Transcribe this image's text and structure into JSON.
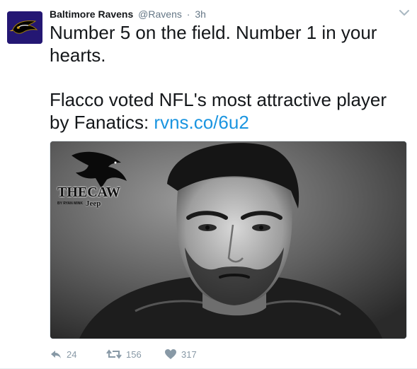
{
  "tweet": {
    "display_name": "Baltimore Ravens",
    "handle": "@Ravens",
    "separator": "·",
    "time": "3h",
    "text_line1": "Number 5 on the field. Number 1 in your hearts.",
    "text_line2_prefix": "Flacco voted NFL's most attractive player by Fanatics: ",
    "link_text": "rvns.co/6u2"
  },
  "media": {
    "logo_text": "THECAW",
    "logo_byline": "BY RYAN MINK",
    "logo_sponsor": "Jeep"
  },
  "actions": {
    "reply_count": "24",
    "retweet_count": "156",
    "like_count": "317"
  },
  "colors": {
    "brand_purple": "#241773",
    "link_blue": "#1b95e0",
    "muted_gray": "#8899a6"
  }
}
